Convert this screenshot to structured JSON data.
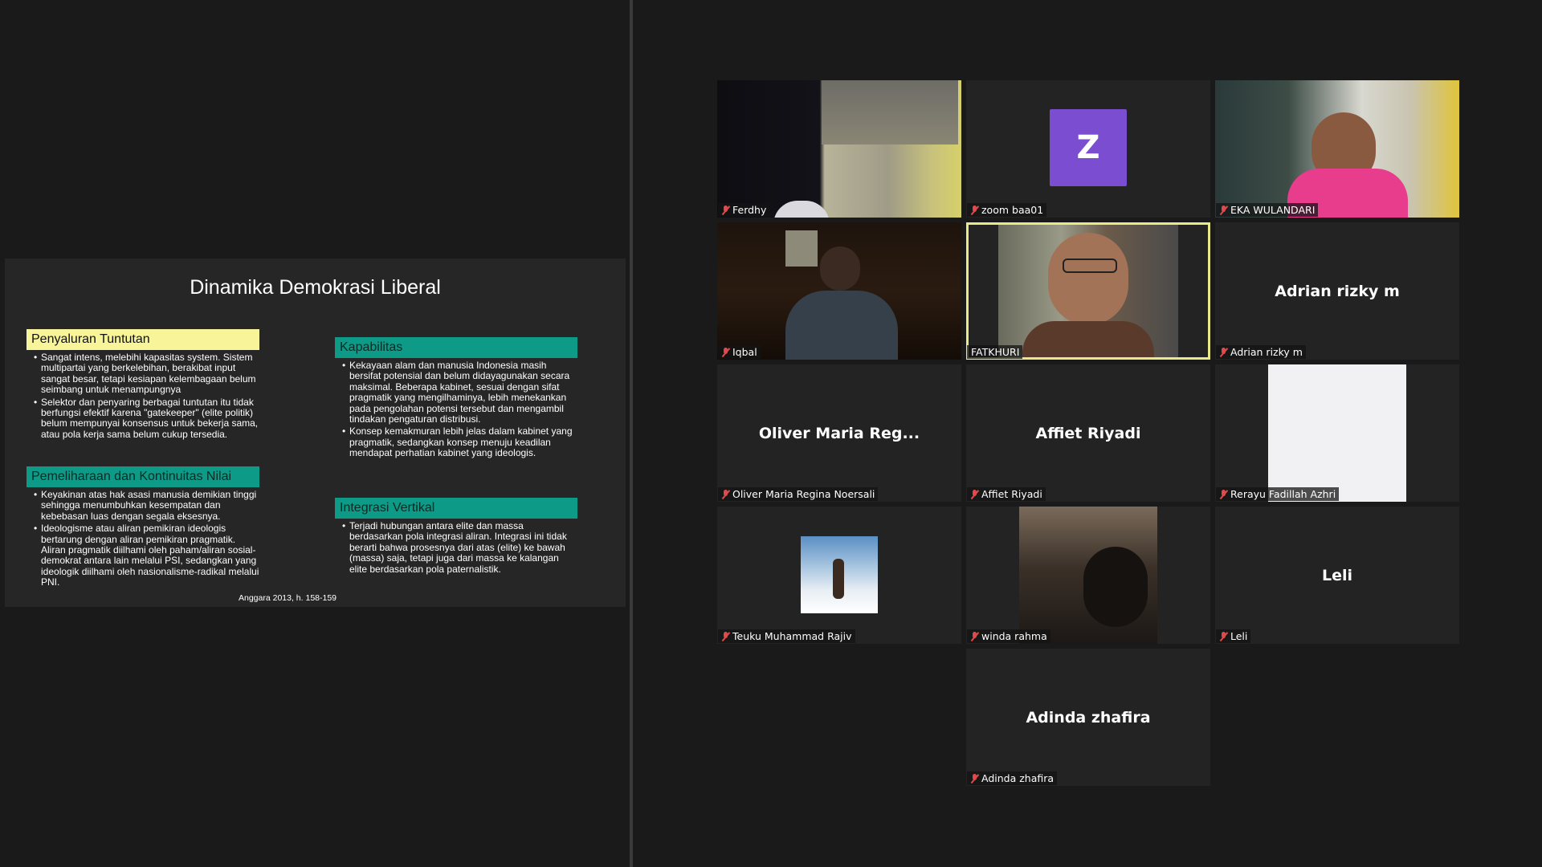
{
  "slide": {
    "title": "Dinamika Demokrasi Liberal",
    "left_sections": [
      {
        "heading": "Penyaluran Tuntutan",
        "bullets": [
          "Sangat intens, melebihi kapasitas system. Sistem multipartai yang berkelebihan, berakibat input sangat besar,  tetapi kesiapan kelembagaan belum seimbang untuk menampungnya",
          "Selektor dan penyaring berbagai tuntutan itu tidak berfungsi efektif karena \"gatekeeper\" (elite politik) belum mempunyai konsensus untuk bekerja sama, atau pola kerja sama belum cukup tersedia."
        ]
      },
      {
        "heading": "Pemeliharaan dan Kontinuitas Nilai",
        "bullets": [
          "Keyakinan atas hak asasi manusia demikian tinggi sehingga  menumbuhkan kesempatan dan kebebasan luas dengan segala  eksesnya.",
          "Ideologisme atau aliran pemikiran ideologis bertarung dengan aliran pemikiran pragmatik. Aliran pragmatik diilhami oleh paham/aliran sosial-demokrat antara lain melalui PSI, sedangkan yang ideologik diilhami oleh nasionalisme-radikal melalui PNI."
        ]
      }
    ],
    "right_sections": [
      {
        "heading": "Kapabilitas",
        "bullets": [
          "Kekayaan alam dan manusia Indonesia masih bersifat potensial dan belum didayagunakan secara maksimal. Beberapa kabinet, sesuai dengan sifat pragmatik yang mengilhaminya, lebih menekankan pada pengolahan potensi tersebut dan mengambil tindakan pengaturan distribusi.",
          "Konsep kemakmuran lebih jelas dalam kabinet yang pragmatik, sedangkan konsep menuju keadilan mendapat perhatian kabinet yang ideologis."
        ]
      },
      {
        "heading": "Integrasi Vertikal",
        "bullets": [
          "Terjadi hubungan antara elite dan massa berdasarkan pola integrasi aliran. Integrasi ini tidak berarti bahwa prosesnya dari atas (elite) ke bawah (massa) saja, tetapi juga dari massa ke kalangan elite berdasarkan pola paternalistik."
        ]
      }
    ],
    "citation": "Anggara 2013, h. 158-159"
  },
  "participants": [
    {
      "label": "Ferdhy",
      "muted": true,
      "type": "video",
      "scene": "room"
    },
    {
      "label": "zoom baa01",
      "muted": true,
      "type": "avatar",
      "initial": "Z",
      "avatar_color": "#7b4ed1"
    },
    {
      "label": "EKA WULANDARI",
      "muted": true,
      "type": "video",
      "scene": "pink"
    },
    {
      "label": "Iqbal",
      "muted": true,
      "type": "video",
      "scene": "dark-room"
    },
    {
      "label": "FATKHURI",
      "muted": false,
      "type": "video",
      "scene": "speaker",
      "active": true
    },
    {
      "label": "Adrian rizky m",
      "muted": true,
      "type": "name",
      "display_name": "Adrian rizky m"
    },
    {
      "label": "Oliver Maria Regina Noersali",
      "muted": true,
      "type": "name",
      "display_name": "Oliver Maria Reg..."
    },
    {
      "label": "Affiet Riyadi",
      "muted": true,
      "type": "name",
      "display_name": "Affiet Riyadi"
    },
    {
      "label": "Rerayu Fadillah Azhri",
      "muted": true,
      "type": "video",
      "scene": "white"
    },
    {
      "label": "Teuku Muhammad Rajiv",
      "muted": true,
      "type": "photo",
      "scene": "snow"
    },
    {
      "label": "winda rahma",
      "muted": true,
      "type": "video",
      "scene": "cat"
    },
    {
      "label": "Leli",
      "muted": true,
      "type": "name",
      "display_name": "Leli"
    },
    {
      "label": "Adinda zhafira",
      "muted": true,
      "type": "name",
      "display_name": "Adinda zhafira"
    }
  ],
  "colors": {
    "active_speaker_border": "#e9e98a",
    "mute_icon": "#e04a4a",
    "slide_yellow": "#f7f49a",
    "slide_teal": "#0d9a86"
  }
}
